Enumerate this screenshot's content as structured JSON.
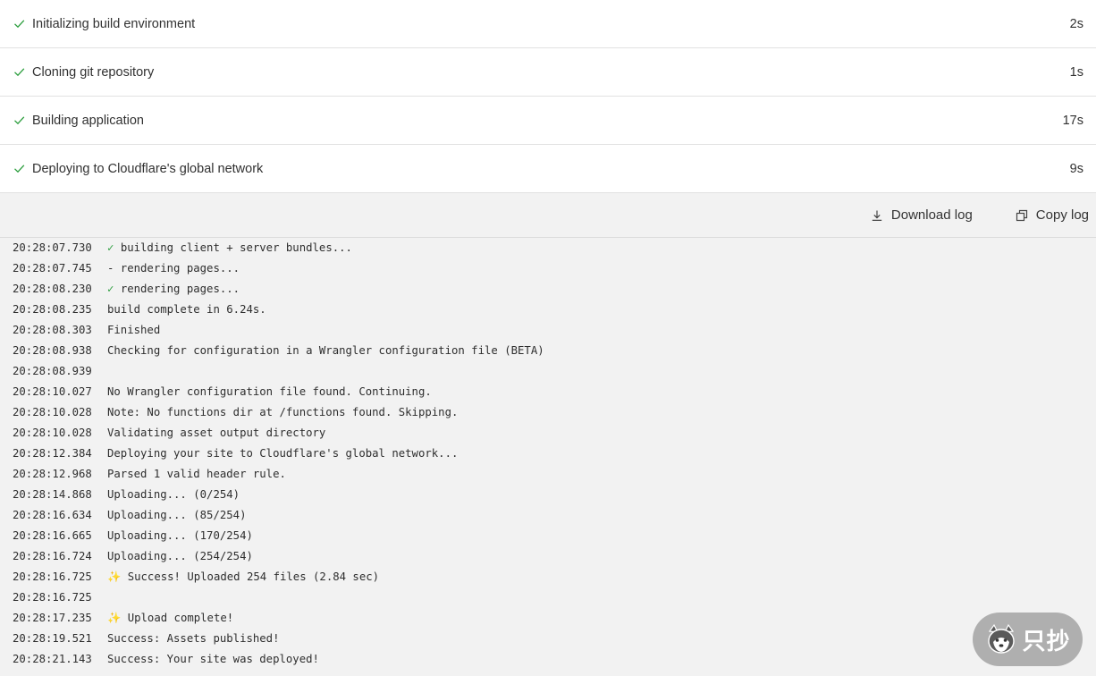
{
  "steps": [
    {
      "label": "Initializing build environment",
      "duration": "2s",
      "icon": "check-icon"
    },
    {
      "label": "Cloning git repository",
      "duration": "1s",
      "icon": "check-icon"
    },
    {
      "label": "Building application",
      "duration": "17s",
      "icon": "check-icon"
    },
    {
      "label": "Deploying to Cloudflare's global network",
      "duration": "9s",
      "icon": "check-icon"
    }
  ],
  "toolbar": {
    "download_label": "Download log",
    "copy_label": "Copy log"
  },
  "log": [
    {
      "time": "20:28:07.730",
      "prefix": "✓ ",
      "prefix_type": "ok",
      "text": "building client + server bundles..."
    },
    {
      "time": "20:28:07.745",
      "prefix": "",
      "prefix_type": "",
      "text": "- rendering pages..."
    },
    {
      "time": "20:28:08.230",
      "prefix": "✓ ",
      "prefix_type": "ok",
      "text": "rendering pages..."
    },
    {
      "time": "20:28:08.235",
      "prefix": "",
      "prefix_type": "",
      "text": "build complete in 6.24s."
    },
    {
      "time": "20:28:08.303",
      "prefix": "",
      "prefix_type": "",
      "text": "Finished"
    },
    {
      "time": "20:28:08.938",
      "prefix": "",
      "prefix_type": "",
      "text": "Checking for configuration in a Wrangler configuration file (BETA)"
    },
    {
      "time": "20:28:08.939",
      "prefix": "",
      "prefix_type": "",
      "text": ""
    },
    {
      "time": "20:28:10.027",
      "prefix": "",
      "prefix_type": "",
      "text": "No Wrangler configuration file found. Continuing."
    },
    {
      "time": "20:28:10.028",
      "prefix": "",
      "prefix_type": "",
      "text": "Note: No functions dir at /functions found. Skipping."
    },
    {
      "time": "20:28:10.028",
      "prefix": "",
      "prefix_type": "",
      "text": "Validating asset output directory"
    },
    {
      "time": "20:28:12.384",
      "prefix": "",
      "prefix_type": "",
      "text": "Deploying your site to Cloudflare's global network..."
    },
    {
      "time": "20:28:12.968",
      "prefix": "",
      "prefix_type": "",
      "text": "Parsed 1 valid header rule."
    },
    {
      "time": "20:28:14.868",
      "prefix": "",
      "prefix_type": "",
      "text": "Uploading... (0/254)"
    },
    {
      "time": "20:28:16.634",
      "prefix": "",
      "prefix_type": "",
      "text": "Uploading... (85/254)"
    },
    {
      "time": "20:28:16.665",
      "prefix": "",
      "prefix_type": "",
      "text": "Uploading... (170/254)"
    },
    {
      "time": "20:28:16.724",
      "prefix": "",
      "prefix_type": "",
      "text": "Uploading... (254/254)"
    },
    {
      "time": "20:28:16.725",
      "prefix": "✨ ",
      "prefix_type": "spark",
      "text": "Success! Uploaded 254 files (2.84 sec)"
    },
    {
      "time": "20:28:16.725",
      "prefix": "",
      "prefix_type": "",
      "text": ""
    },
    {
      "time": "20:28:17.235",
      "prefix": "✨ ",
      "prefix_type": "spark",
      "text": "Upload complete!"
    },
    {
      "time": "20:28:19.521",
      "prefix": "",
      "prefix_type": "",
      "text": "Success: Assets published!"
    },
    {
      "time": "20:28:21.143",
      "prefix": "",
      "prefix_type": "",
      "text": "Success: Your site was deployed!"
    }
  ],
  "watermark": {
    "text": "只抄",
    "icon": "husky-icon"
  },
  "colors": {
    "check": "#2a9d3c",
    "log_bg": "#f2f2f2",
    "divider": "#e2e2e2"
  }
}
